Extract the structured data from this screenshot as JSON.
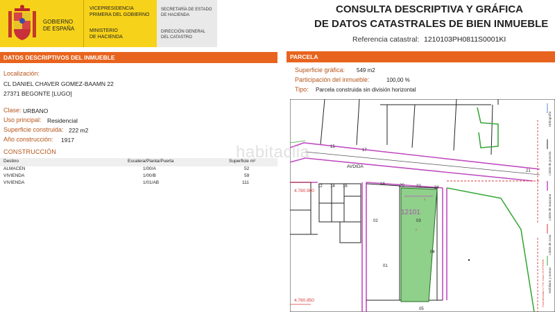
{
  "header": {
    "gobierno": [
      "GOBIERNO",
      "DE ESPAÑA"
    ],
    "vicepresidencia": [
      "VICEPRESIDENCIA",
      "PRIMERA DEL GOBIERNO"
    ],
    "ministerio": [
      "MINISTERIO",
      "DE HACIENDA"
    ],
    "secretaria": [
      "SECRETARÍA DE ESTADO",
      "DE HACIENDA"
    ],
    "direccion": [
      "DIRECCIÓN GENERAL",
      "DEL CATASTRO"
    ],
    "title_line1": "CONSULTA DESCRIPTIVA Y GRÁFICA",
    "title_line2": "DE DATOS CATASTRALES DE BIEN INMUEBLE",
    "ref_label": "Referencia catastral:",
    "ref_value": "1210103PH0811S0001KI"
  },
  "left": {
    "section_title": "DATOS DESCRIPTIVOS DEL INMUEBLE",
    "localizacion_label": "Localización:",
    "localizacion_lines": [
      "CL DANIEL CHAVER GOMEZ-BAAMN 22",
      "27371 BEGONTE [LUGO]"
    ],
    "clase_label": "Clase:",
    "clase_value": "URBANO",
    "uso_label": "Uso principal:",
    "uso_value": "Residencial",
    "superficie_label": "Superficie construida:",
    "superficie_value": "222 m2",
    "anio_label": "Año construcción:",
    "anio_value": "1917",
    "construccion_title": "CONSTRUCCIÓN",
    "table": {
      "headers": [
        "Destino",
        "Escalera/Planta/Puerta",
        "Superficie m²"
      ],
      "rows": [
        [
          "ALMACEN",
          "1/00/A",
          "52"
        ],
        [
          "VIVIENDA",
          "1/00/B",
          "59"
        ],
        [
          "VIVIENDA",
          "1/01/AB",
          "111"
        ]
      ]
    }
  },
  "right": {
    "section_title": "PARCELA",
    "sup_grafica_label": "Superficie gráfica:",
    "sup_grafica_value": "549 m2",
    "participacion_label": "Participación del inmueble:",
    "participacion_value": "100,00 %",
    "tipo_label": "Tipo:",
    "tipo_value": "Parcela construida sin división horizontal"
  },
  "map": {
    "street": "AVDIDA",
    "parcel_id": "12101",
    "coord_top": "4.780.900",
    "coord_bottom": "4.780.850",
    "numbers": {
      "n15": "15",
      "n17": "17",
      "n21": "21",
      "n12": "12",
      "n14": "14",
      "n16": "16",
      "n18": "18",
      "n20": "20",
      "n22": "22",
      "n24": "24",
      "p02": "02",
      "p03": "03",
      "p04": "04",
      "p01": "01",
      "p05": "05"
    },
    "legend": [
      "Hidrografía",
      "Límite de parcela",
      "Límite de manzana",
      "Límite de zona",
      "Mobiliario y aceras"
    ],
    "side_text": "Coordenadas U.T.M. Huso 29 ETRS89",
    "colors": {
      "parcel_fill": "#8fd08a",
      "road_line": "#c04cc0",
      "green_line": "#3aa83a",
      "red_line": "#d83a3a"
    }
  },
  "watermark": "habitaclia"
}
